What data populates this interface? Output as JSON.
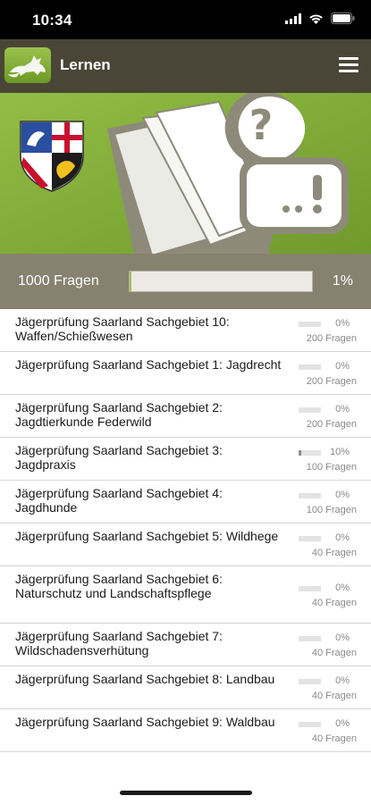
{
  "status": {
    "time": "10:34"
  },
  "header": {
    "title": "Lernen",
    "logo_icon": "fox-icon",
    "menu_icon": "hamburger-menu-icon"
  },
  "banner": {
    "coat_of_arms": "saarland-coat-of-arms",
    "illustration": "book-question-icon"
  },
  "summary": {
    "label": "1000 Fragen",
    "percent_text": "1%",
    "percent": 1
  },
  "colors": {
    "header_bg": "#4a4637",
    "banner_bg": "#86b33f",
    "summary_bg": "#87826f",
    "accent": "#a2c35a"
  },
  "topics": [
    {
      "title": "Jägerprüfung Saarland Sachgebiet 10: Waffen/Schießwesen",
      "percent_text": "0%",
      "percent": 0,
      "count": "200 Fragen"
    },
    {
      "title": "Jägerprüfung Saarland Sachgebiet 1: Jagdrecht",
      "percent_text": "0%",
      "percent": 0,
      "count": "200 Fragen"
    },
    {
      "title": "Jägerprüfung Saarland Sachgebiet 2: Jagdtierkunde Federwild",
      "percent_text": "0%",
      "percent": 0,
      "count": "200 Fragen"
    },
    {
      "title": "Jägerprüfung Saarland Sachgebiet 3: Jagdpraxis",
      "percent_text": "10%",
      "percent": 10,
      "count": "100 Fragen"
    },
    {
      "title": "Jägerprüfung Saarland Sachgebiet 4: Jagdhunde",
      "percent_text": "0%",
      "percent": 0,
      "count": "100 Fragen"
    },
    {
      "title": "Jägerprüfung Saarland Sachgebiet 5: Wildhege",
      "percent_text": "0%",
      "percent": 0,
      "count": "40 Fragen"
    },
    {
      "title": "Jägerprüfung Saarland Sachgebiet 6: Naturschutz und Landschaftspflege",
      "percent_text": "0%",
      "percent": 0,
      "count": "40 Fragen"
    },
    {
      "title": "Jägerprüfung Saarland Sachgebiet 7: Wildschadensverhütung",
      "percent_text": "0%",
      "percent": 0,
      "count": "40 Fragen"
    },
    {
      "title": "Jägerprüfung Saarland Sachgebiet 8: Landbau",
      "percent_text": "0%",
      "percent": 0,
      "count": "40 Fragen"
    },
    {
      "title": "Jägerprüfung Saarland Sachgebiet 9: Waldbau",
      "percent_text": "0%",
      "percent": 0,
      "count": "40 Fragen"
    }
  ]
}
